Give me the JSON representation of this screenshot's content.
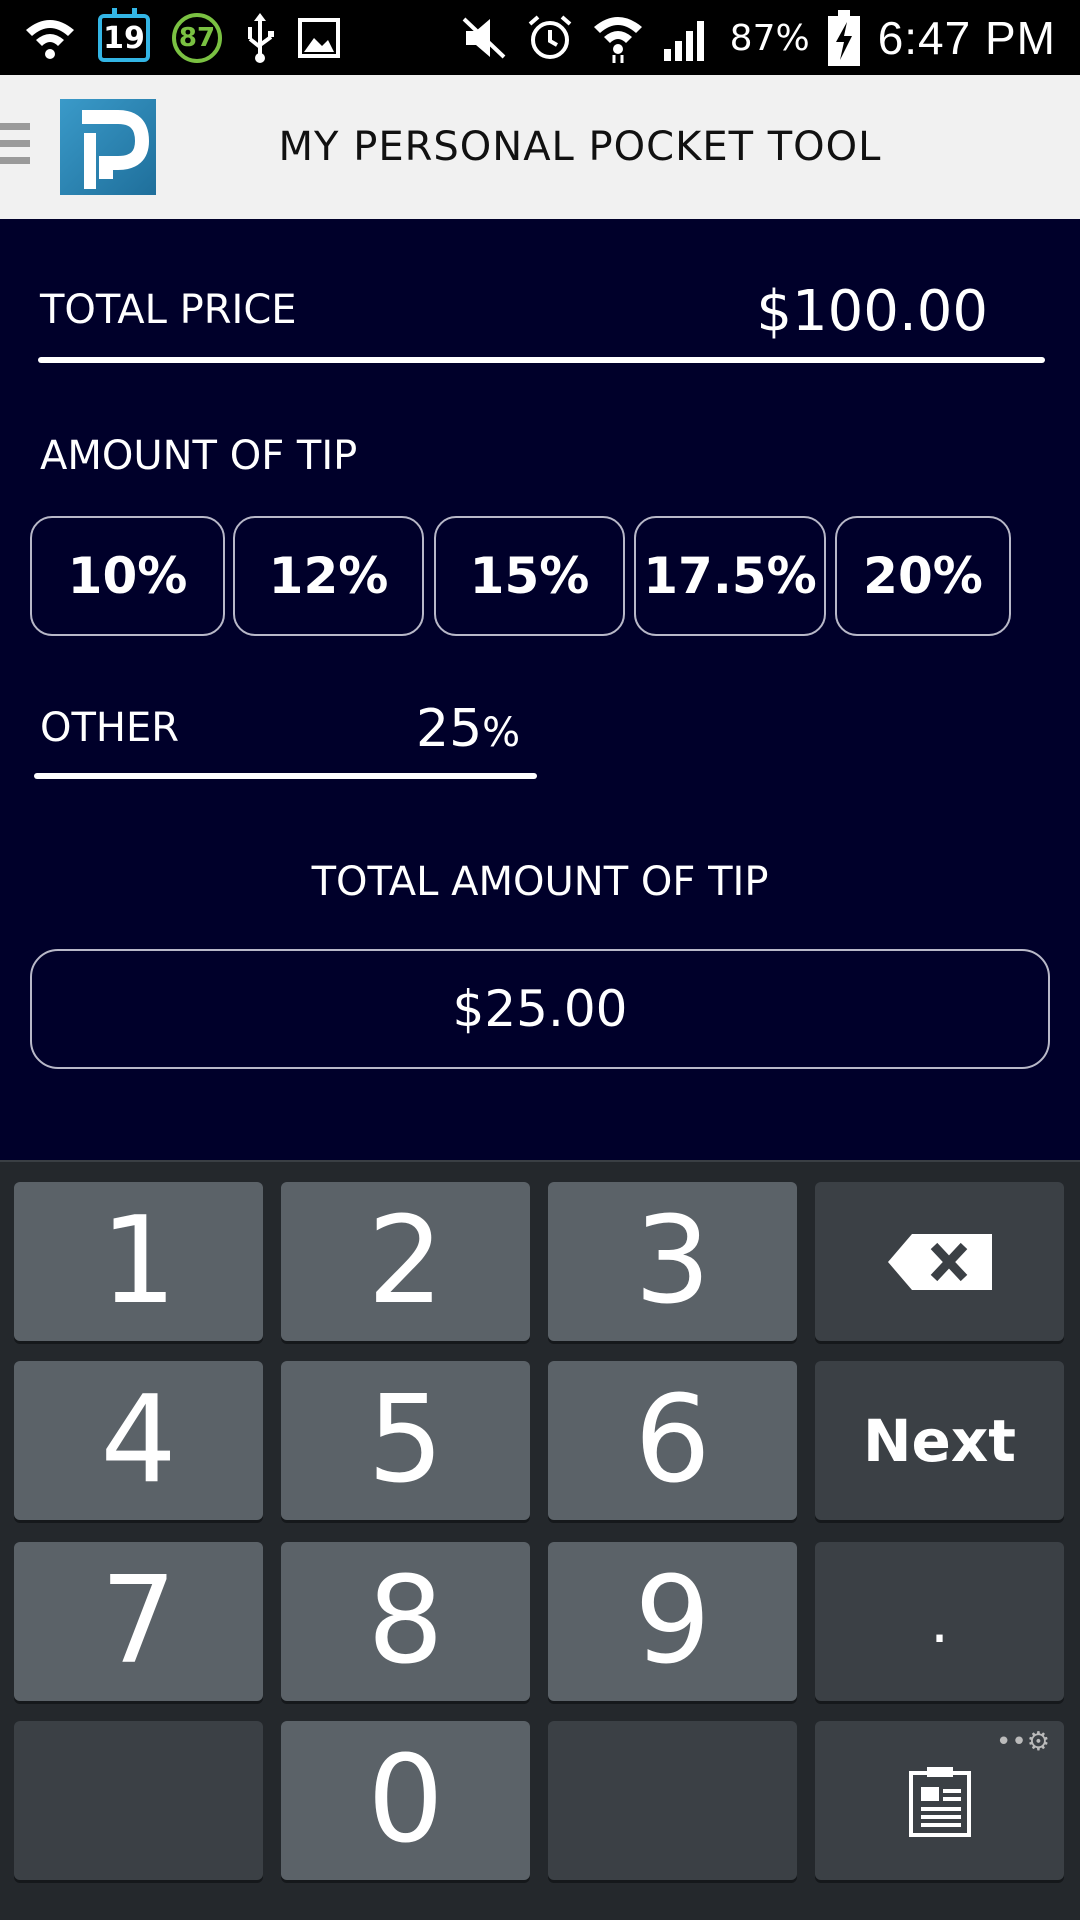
{
  "status_bar": {
    "calendar_day": "19",
    "battery_badge": "87",
    "battery_percent": "87%",
    "time": "6:47 PM"
  },
  "app": {
    "title": "MY PERSONAL POCKET TOOL",
    "logo_letter": "P"
  },
  "form": {
    "total_price_label": "TOTAL PRICE",
    "total_price_value": "$100.00",
    "amount_of_tip_label": "AMOUNT OF TIP",
    "tip_options": [
      "10%",
      "12%",
      "15%",
      "17.5%",
      "20%"
    ],
    "other_label": "OTHER",
    "other_value": "25",
    "other_unit": "%",
    "total_tip_label": "TOTAL AMOUNT OF TIP",
    "total_tip_value": "$25.00"
  },
  "keyboard": {
    "keys": [
      "1",
      "2",
      "3",
      "4",
      "5",
      "6",
      "7",
      "8",
      "9",
      "0"
    ],
    "next_label": "Next",
    "dot_label": "."
  },
  "colors": {
    "background": "#00002a",
    "accent": "#33b5e5",
    "battery": "#7ac142"
  }
}
